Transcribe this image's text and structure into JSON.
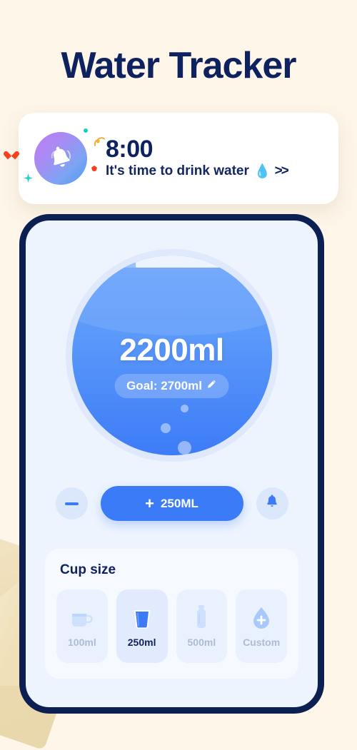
{
  "page": {
    "title": "Water Tracker",
    "background_color": "#fdf6e9",
    "accent_color": "#3b7bf7",
    "navy_color": "#0f2260"
  },
  "notification": {
    "icon": "bell-icon",
    "time": "8:00",
    "message": "It's time to drink water",
    "message_emoji": "💧",
    "chevrons": ">>"
  },
  "tracker": {
    "amount": "2200ml",
    "goal_label": "Goal: 2700ml",
    "goal_edit_icon": "pencil-icon"
  },
  "actions": {
    "decrease_icon": "minus-icon",
    "add_label": "250ML",
    "add_icon": "plus-icon",
    "reminder_icon": "bell-icon"
  },
  "cup_size": {
    "title": "Cup size",
    "options": [
      {
        "label": "100ml",
        "icon": "mug-icon",
        "selected": false
      },
      {
        "label": "250ml",
        "icon": "cup-icon",
        "selected": true
      },
      {
        "label": "500ml",
        "icon": "bottle-icon",
        "selected": false
      },
      {
        "label": "Custom",
        "icon": "droplet-plus-icon",
        "selected": false
      }
    ]
  }
}
